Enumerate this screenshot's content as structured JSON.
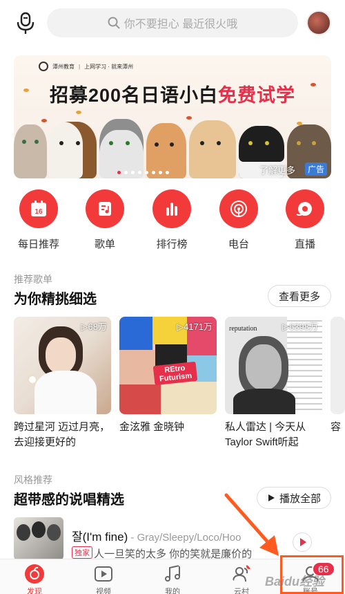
{
  "search": {
    "placeholder": "你不要担心 最近很火哦"
  },
  "banner": {
    "brand": "潭州教育",
    "brand_tag": "上网学习 · 就来潭州",
    "headline_main": "招募200名日语小白",
    "headline_accent": "免费试学",
    "more": "了解更多",
    "ad": "广告"
  },
  "shortcuts": [
    {
      "label": "每日推荐",
      "icon": "calendar-icon",
      "day": "16"
    },
    {
      "label": "歌单",
      "icon": "playlist-icon"
    },
    {
      "label": "排行榜",
      "icon": "bar-chart-icon"
    },
    {
      "label": "电台",
      "icon": "radio-icon"
    },
    {
      "label": "直播",
      "icon": "live-icon"
    }
  ],
  "recommend": {
    "subtitle": "推荐歌单",
    "title": "为你精挑细选",
    "more_label": "查看更多",
    "playlists": [
      {
        "plays": "▷68万",
        "title": "跨过星河 迈过月亮，去迎接更好的"
      },
      {
        "plays": "▷4171万",
        "title": "金泫雅 金晓钟"
      },
      {
        "plays": "▷6398万",
        "title": "私人雷达 | 今天从Taylor Swift听起"
      },
      {
        "plays": "",
        "title": "容"
      }
    ],
    "cover_texts": {
      "retro": "REtro Futurism",
      "reputation": "reputation"
    }
  },
  "style": {
    "subtitle": "风格推荐",
    "title": "超带感的说唱精选",
    "play_all": "播放全部",
    "song": {
      "name": "잘(I'm fine)",
      "artist": " - Gray/Sleepy/Loco/Hoo",
      "exclusive": "独家",
      "lyric": "人一旦笑的太多 你的笑就是廉价的"
    }
  },
  "tabs": [
    {
      "label": "发现",
      "icon": "discover-icon",
      "active": true
    },
    {
      "label": "视频",
      "icon": "video-icon"
    },
    {
      "label": "我的",
      "icon": "music-note-icon"
    },
    {
      "label": "云村",
      "icon": "community-icon"
    },
    {
      "label": "账号",
      "icon": "account-icon"
    }
  ],
  "badge": "66",
  "watermark": "Baidu经验",
  "colors": {
    "accent": "#f23a3a",
    "highlight": "#ff5a1f",
    "ad": "#3a7bd5"
  }
}
